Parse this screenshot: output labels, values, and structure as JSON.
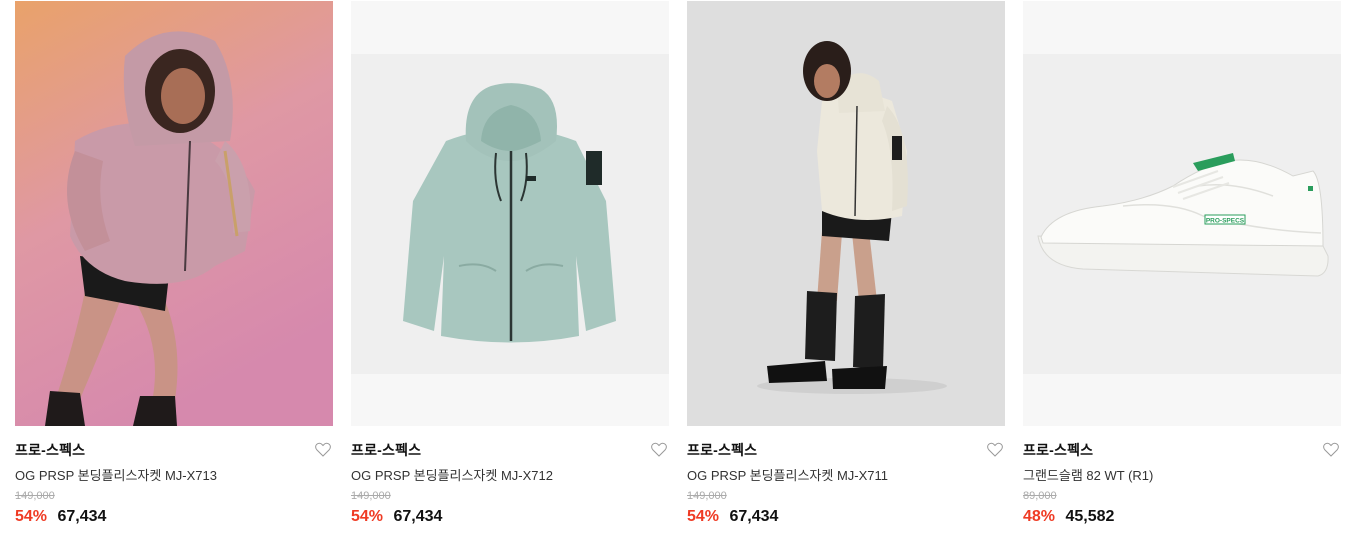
{
  "products": [
    {
      "image": "woman-in-pink-fleece-jacket-photo",
      "brand": "프로-스펙스",
      "title": "OG PRSP 본딩플리스자켓 MJ-X713",
      "original_price": "149,000",
      "discount": "54%",
      "price": "67,434"
    },
    {
      "image": "mint-fleece-hoodie-jacket-photo",
      "brand": "프로-스펙스",
      "title": "OG PRSP 본딩플리스자켓 MJ-X712",
      "original_price": "149,000",
      "discount": "54%",
      "price": "67,434"
    },
    {
      "image": "woman-in-ivory-fleece-jacket-photo",
      "brand": "프로-스펙스",
      "title": "OG PRSP 본딩플리스자켓 MJ-X711",
      "original_price": "149,000",
      "discount": "54%",
      "price": "67,434"
    },
    {
      "image": "white-sneaker-photo",
      "brand": "프로-스펙스",
      "title": "그랜드슬램 82 WT (R1)",
      "original_price": "89,000",
      "discount": "48%",
      "price": "45,582"
    }
  ],
  "sneaker_logo_text": "PRO-SPECS",
  "colors": {
    "discount": "#ef3b24",
    "brand_text": "#111111",
    "strike_price": "#aaaaaa",
    "heart_outline": "#999999"
  }
}
